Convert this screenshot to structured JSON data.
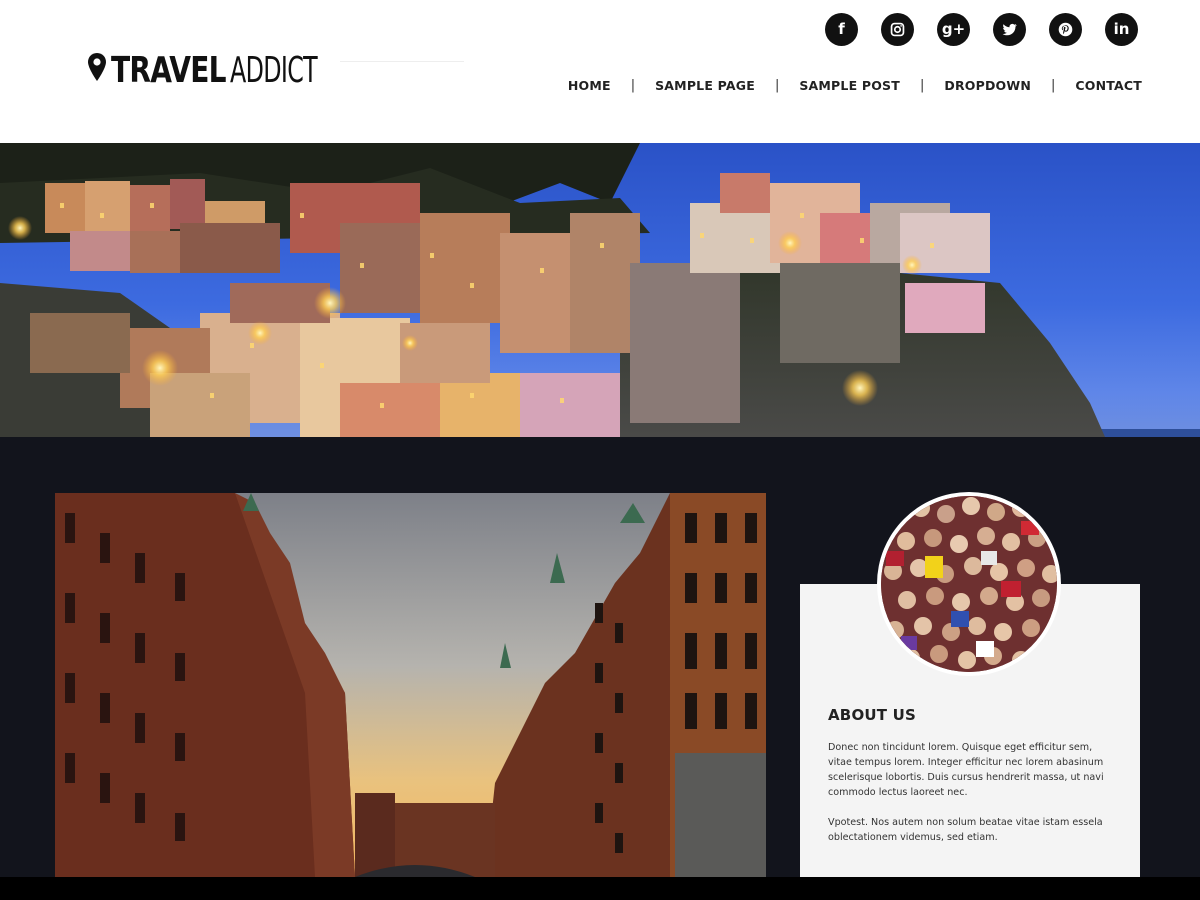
{
  "site": {
    "logo_bold": "TRAVEL",
    "logo_light": "ADDICT"
  },
  "social": [
    {
      "icon": "facebook-icon",
      "glyph": "f"
    },
    {
      "icon": "instagram-icon",
      "glyph": ""
    },
    {
      "icon": "google-plus-icon",
      "glyph": "g+"
    },
    {
      "icon": "twitter-icon",
      "glyph": ""
    },
    {
      "icon": "pinterest-icon",
      "glyph": "P"
    },
    {
      "icon": "linkedin-icon",
      "glyph": "in"
    }
  ],
  "nav": {
    "items": [
      "HOME",
      "SAMPLE PAGE",
      "SAMPLE POST",
      "DROPDOWN",
      "CONTACT"
    ],
    "separator": "|"
  },
  "about": {
    "title": "ABOUT US",
    "paragraph1": "Donec non tincidunt lorem. Quisque eget efficitur sem, vitae tempus lorem. Integer efficitur nec lorem  abasinum scelerisque lobortis. Duis cursus hendrerit massa, ut navi commodo lectus laoreet nec.",
    "paragraph2": "Vpotest. Nos autem non solum beatae vitae istam essela oblectationem videmus, sed etiam."
  },
  "colors": {
    "dark_bg": "#12141c",
    "panel_bg": "#f4f4f4",
    "text": "#222222",
    "social_bg": "#111111"
  }
}
